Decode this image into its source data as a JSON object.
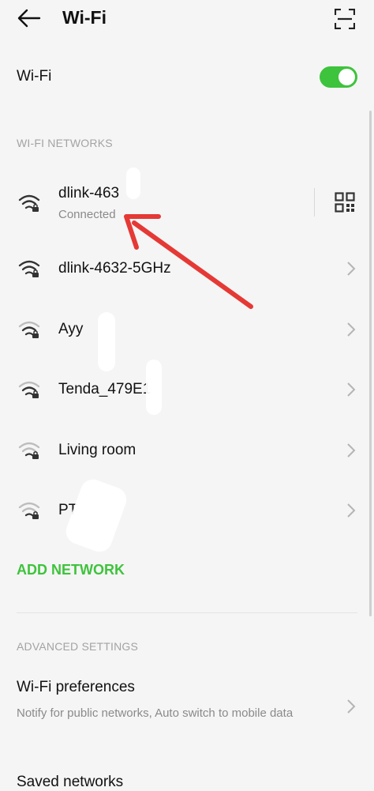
{
  "header": {
    "title": "Wi-Fi",
    "back_icon": "arrow-left-icon",
    "scan_icon": "qr-scan-icon"
  },
  "wifi_toggle": {
    "label": "Wi-Fi",
    "on": true,
    "color": "#3ec33c"
  },
  "networks_header": "WI-FI NETWORKS",
  "networks": [
    {
      "name": "dlink-463",
      "status": "Connected"
    },
    {
      "name": "dlink-4632-5GHz"
    },
    {
      "name": "Ayy"
    },
    {
      "name": "Tenda_479E1"
    },
    {
      "name": "Living room"
    },
    {
      "name": "PT"
    }
  ],
  "add_network": "ADD NETWORK",
  "advanced_header": "ADVANCED SETTINGS",
  "preferences": {
    "title": "Wi-Fi preferences",
    "desc": "Notify for public networks, Auto switch to mobile data"
  },
  "saved_networks": "Saved networks",
  "annotation": {
    "arrow_color": "#e53935"
  }
}
